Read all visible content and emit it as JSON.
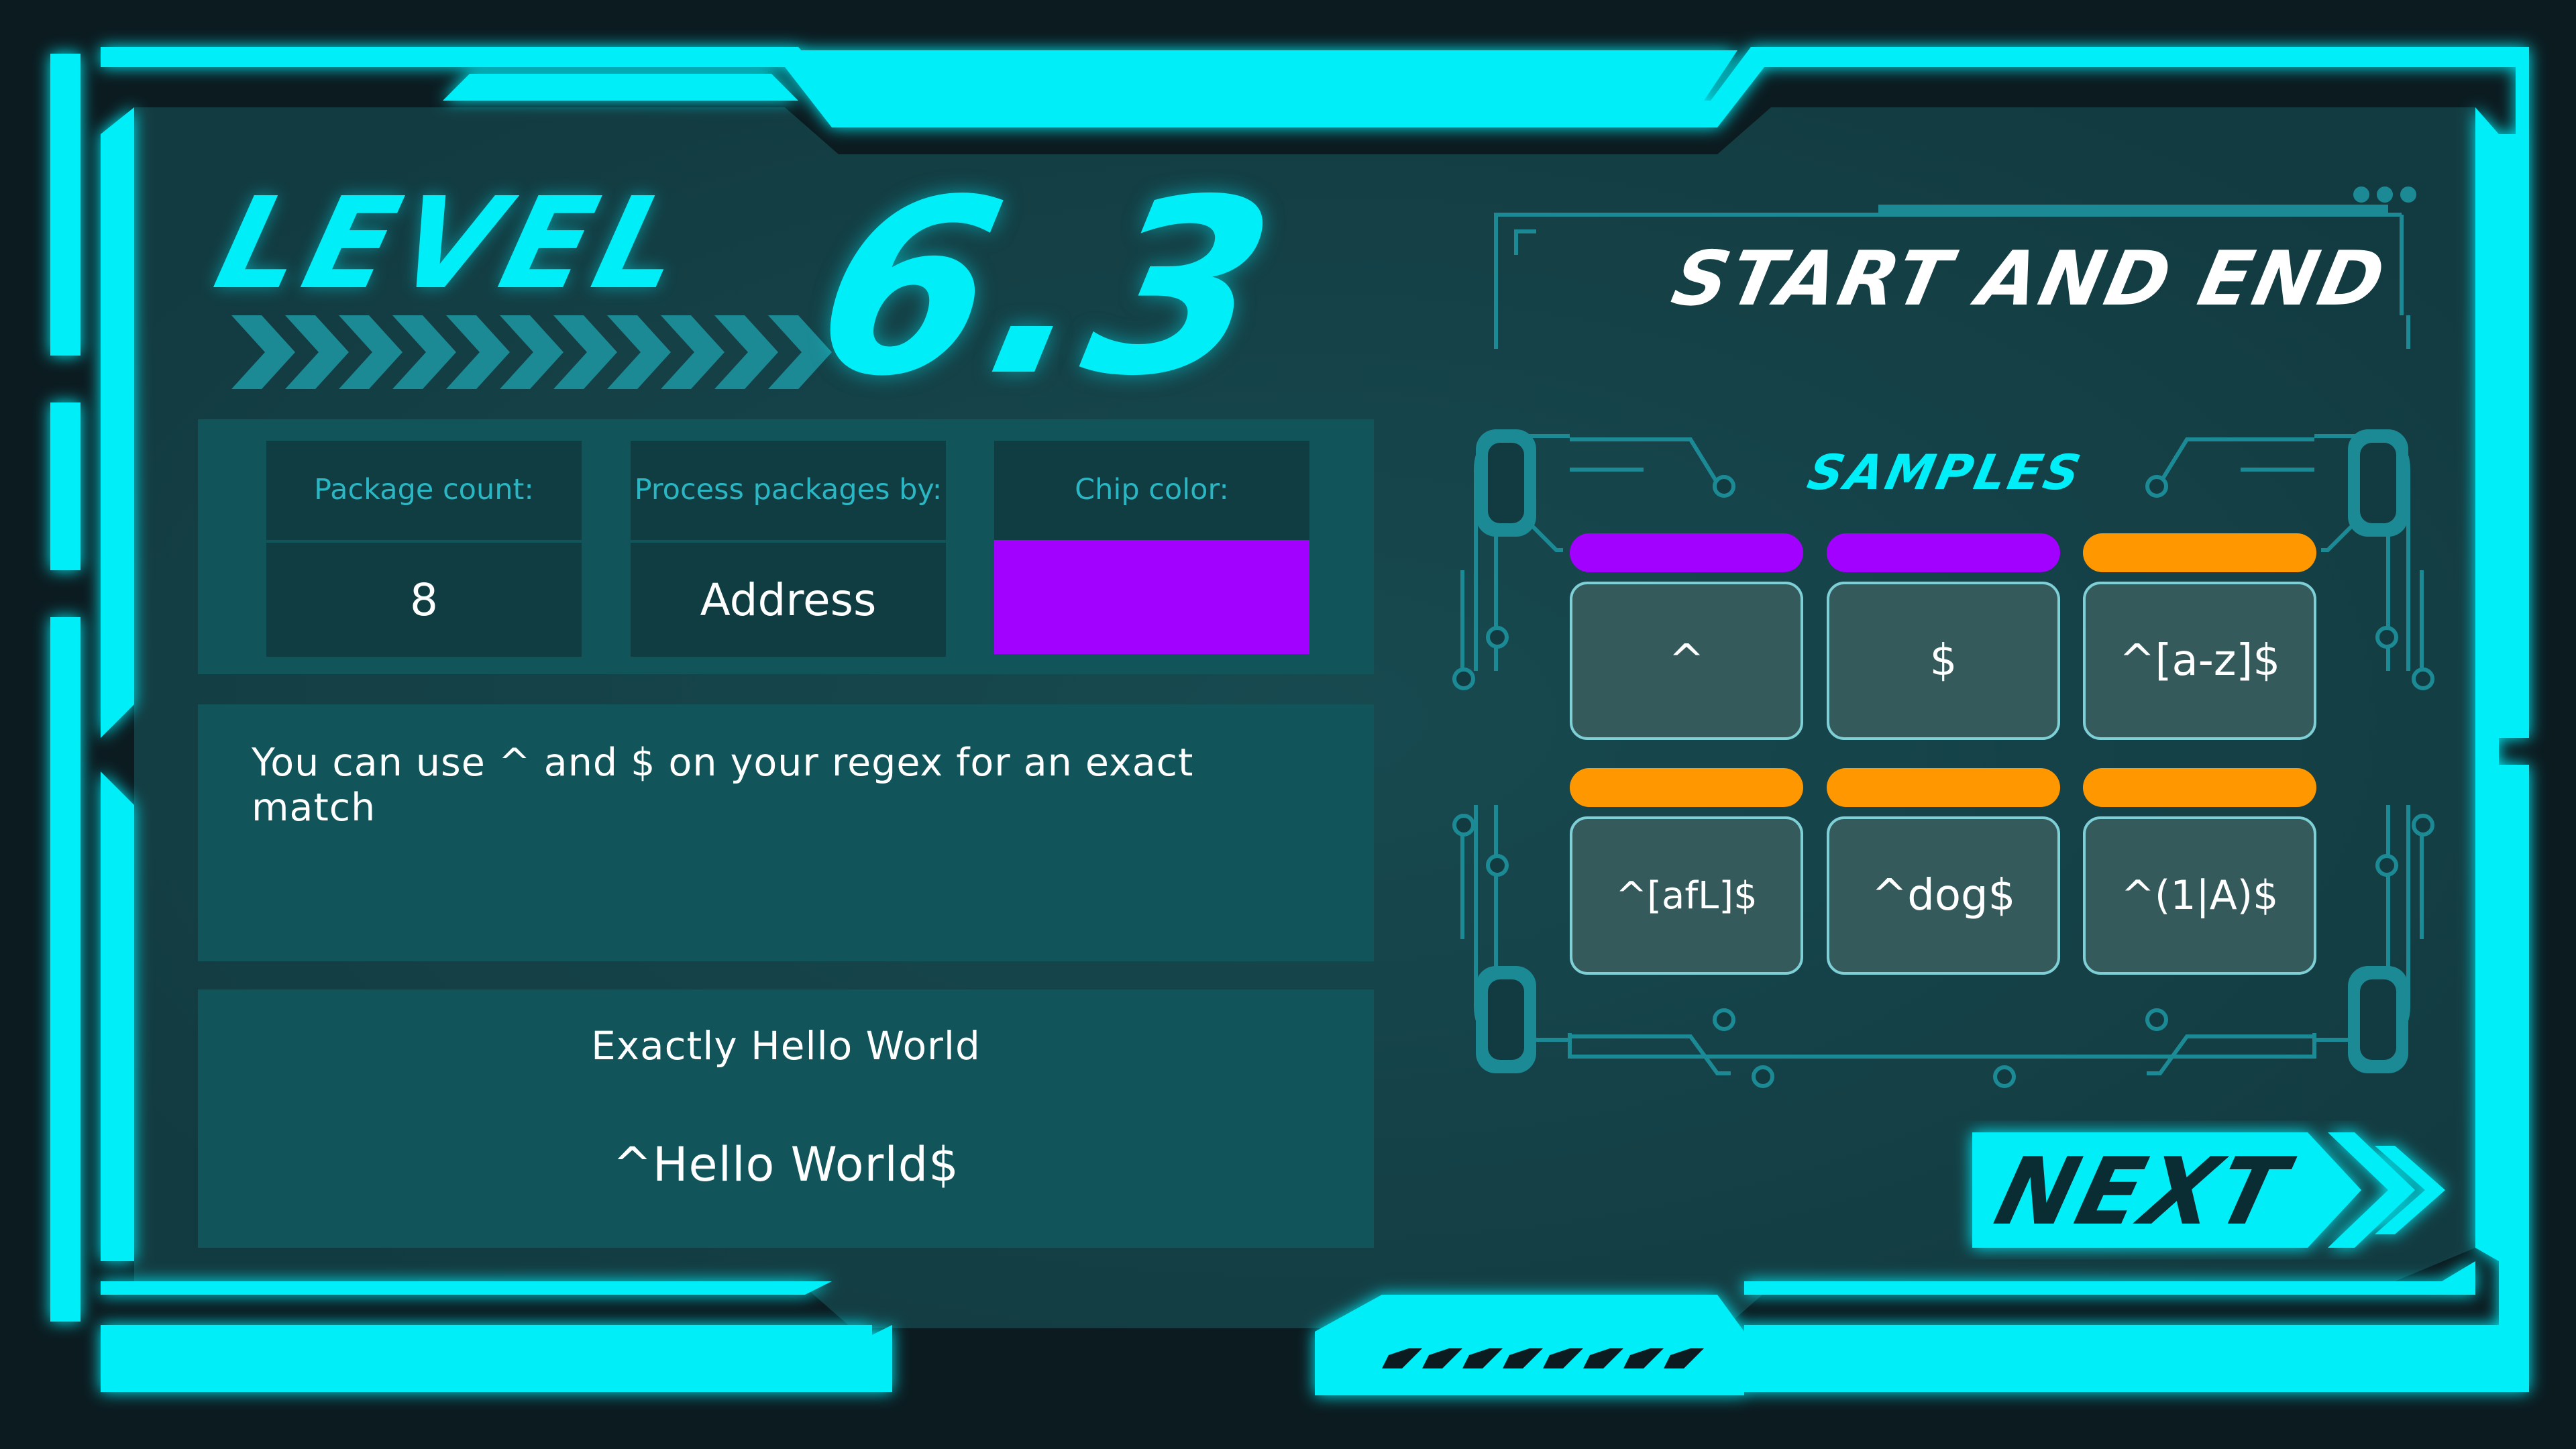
{
  "level": {
    "word": "LEVEL",
    "number": "6.3",
    "title": "START AND END"
  },
  "info": {
    "package_count_label": "Package count:",
    "package_count_value": "8",
    "process_label": "Process packages by:",
    "process_value": "Address",
    "chip_color_label": "Chip color:",
    "chip_color_value": "#a200ff"
  },
  "hint": "You can use ^ and $ on your regex for an exact match",
  "example": {
    "title": "Exactly Hello World",
    "pattern": "^Hello World$"
  },
  "samples": {
    "label": "SAMPLES",
    "items": [
      {
        "text": "^",
        "color": "#a200ff"
      },
      {
        "text": "$",
        "color": "#a200ff"
      },
      {
        "text": "^[a-z]$",
        "color": "#ff9800"
      },
      {
        "text": "^[afL]$",
        "color": "#ff9800"
      },
      {
        "text": "^dog$",
        "color": "#ff9800"
      },
      {
        "text": "^(1|A)$",
        "color": "#ff9800"
      }
    ]
  },
  "next_label": "NEXT",
  "colors": {
    "accent": "#00eef8",
    "panel": "#11555b",
    "background": "#0b1b20"
  }
}
